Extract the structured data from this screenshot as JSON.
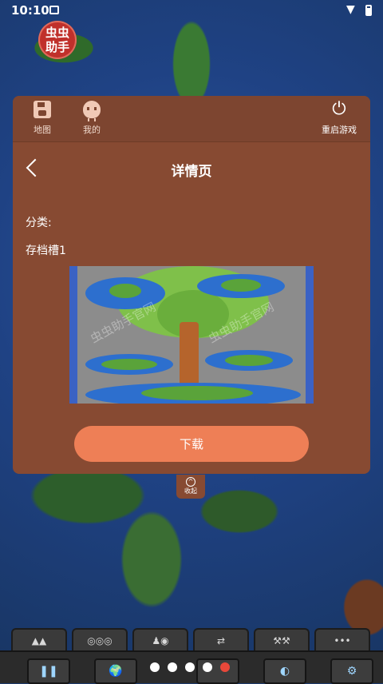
{
  "status_bar": {
    "time": "10:10"
  },
  "logo": {
    "line1": "虫虫",
    "line2": "助手"
  },
  "top_nav": {
    "map_label": "地图",
    "mine_label": "我的",
    "restart_label": "重启游戏"
  },
  "detail": {
    "title": "详情页",
    "category_label": "分类:",
    "slot_name": "存档槽1",
    "watermark": "虫虫助手官网",
    "download_label": "下载"
  },
  "collapse": {
    "label": "收起"
  },
  "toolbar": {
    "tabs": [
      "▲▲",
      "◎◎◎",
      "♟◉",
      "⇄",
      "⚒⚒",
      "•••"
    ],
    "tools": [
      "❚❚",
      "🌍",
      "",
      "",
      "◐",
      "⚙"
    ]
  },
  "page_dots": {
    "count": 5,
    "active_index": 4
  },
  "colors": {
    "panel": "#874a32",
    "button": "#ee7f56",
    "active_dot": "#e8483a"
  }
}
